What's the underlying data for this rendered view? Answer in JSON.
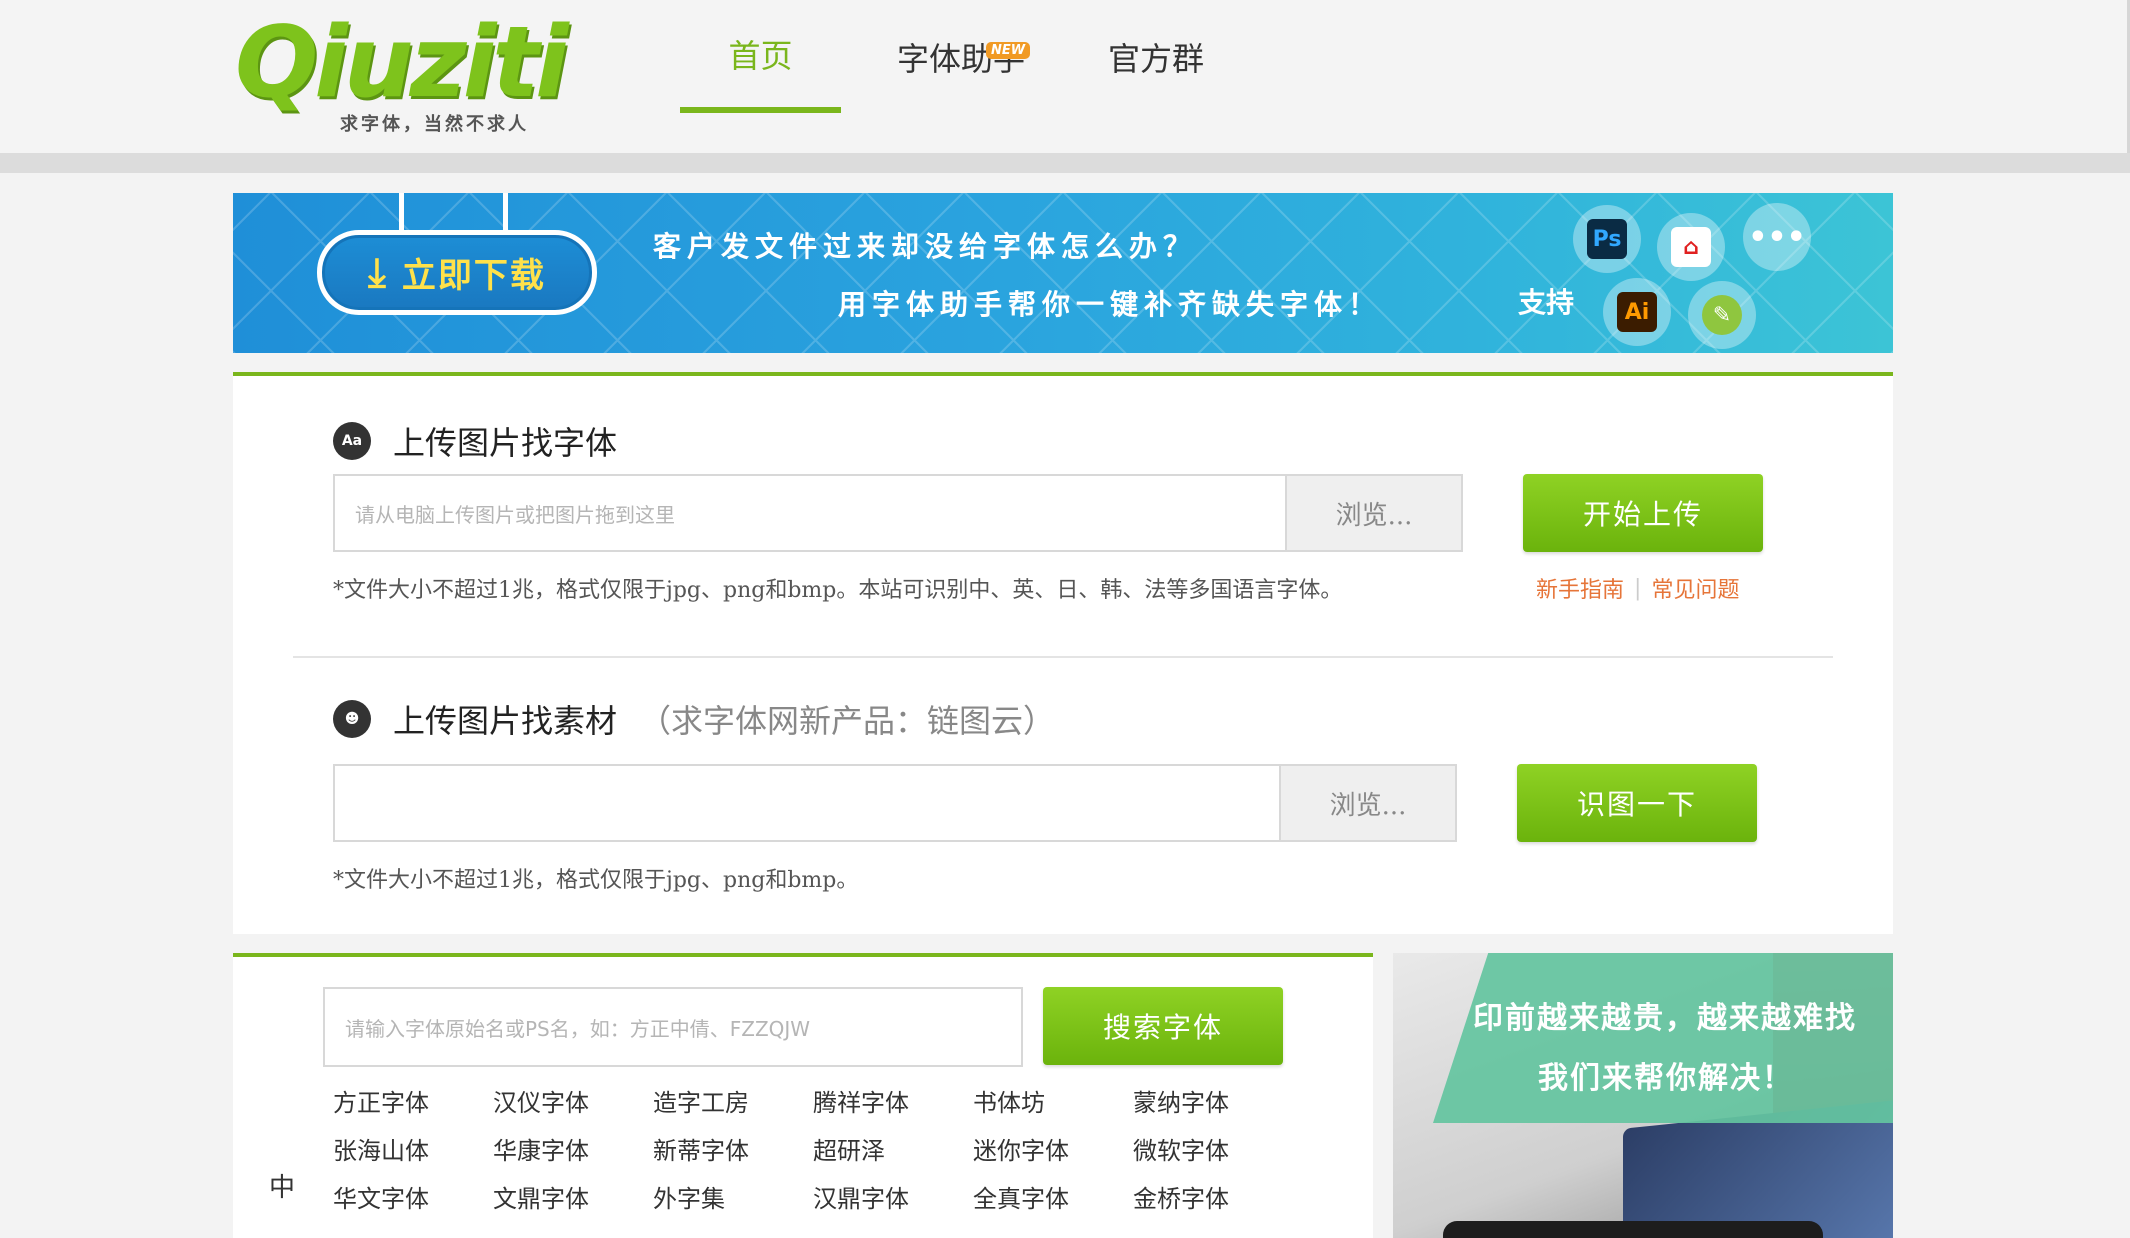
{
  "header": {
    "logo_text": "Qiuziti",
    "logo_slogan": "求字体，当然不求人",
    "nav": [
      {
        "label": "首页"
      },
      {
        "label": "字体助手",
        "badge": "NEW"
      },
      {
        "label": "官方群"
      }
    ],
    "accent_color": "#7ab61c"
  },
  "banner": {
    "download_label": "立即下载",
    "line1": "客户发文件过来却没给字体怎么办？",
    "line2": "用字体助手帮你一键补齐缺失字体！",
    "support_label": "支持",
    "app_icons": [
      "Ps",
      "pdf-icon",
      "more-icon",
      "Ai",
      "corel-icon"
    ]
  },
  "font_upload": {
    "title": "上传图片找字体",
    "placeholder": "请从电脑上传图片或把图片拖到这里",
    "browse_label": "浏览...",
    "submit_label": "开始上传",
    "note": "*文件大小不超过1兆，格式仅限于jpg、png和bmp。本站可识别中、英、日、韩、法等多国语言字体。",
    "help_links": [
      "新手指南",
      "常见问题"
    ]
  },
  "material_upload": {
    "title": "上传图片找素材",
    "subtitle": "（求字体网新产品：链图云）",
    "browse_label": "浏览...",
    "submit_label": "识图一下",
    "note": "*文件大小不超过1兆，格式仅限于jpg、png和bmp。"
  },
  "font_search": {
    "placeholder": "请输入字体原始名或PS名，如：方正中倩、FZZQJW",
    "button_label": "搜索字体",
    "category_label": "中",
    "brands": [
      "方正字体",
      "汉仪字体",
      "造字工房",
      "腾祥字体",
      "书体坊",
      "蒙纳字体",
      "张海山体",
      "华康字体",
      "新蒂字体",
      "超研泽",
      "迷你字体",
      "微软字体",
      "华文字体",
      "文鼎字体",
      "外字集",
      "汉鼎字体",
      "全真字体",
      "金桥字体"
    ]
  },
  "ad": {
    "line1": "印前越来越贵，越来越难找",
    "line2": "我们来帮你解决！"
  }
}
